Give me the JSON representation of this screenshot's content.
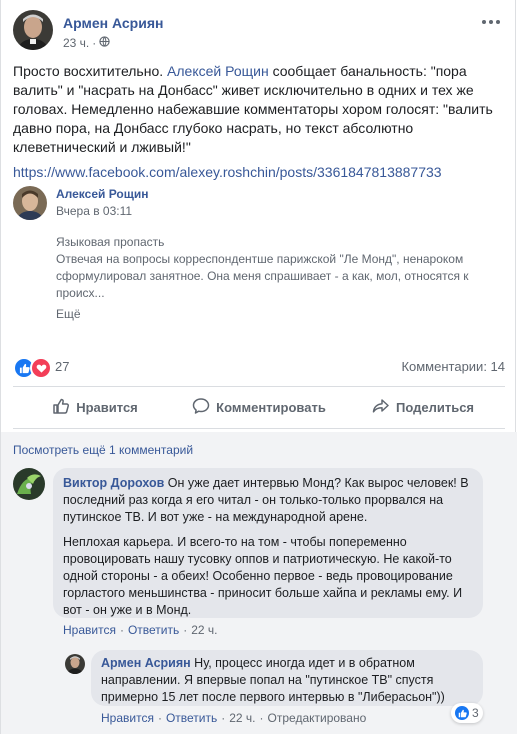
{
  "post": {
    "author": "Армен Асриян",
    "time": "23 ч.",
    "text_before": "Просто восхитительно. ",
    "mention": "Алексей Рощин",
    "text_after": " сообщает банальность: \"пора валить\" и \"насрать на Донбасс\" живет исключительно в одних и тех же головах. Немедленно набежавшие комментаторы хором голосят: \"валить давно пора, на Донбасс глубоко насрать, но текст абсолютно клеветнический и лживый!\"",
    "link": "https://www.facebook.com/alexey.roshchin/posts/3361847813887733"
  },
  "shared": {
    "author": "Алексей Рощин",
    "time": "Вчера в 03:11",
    "title": "Языковая пропасть",
    "body": "Отвечая на вопросы корреспондентше парижской \"Ле Монд\", ненароком сформулировал занятное. Она меня спрашивает - а как, мол, относятся к происх...",
    "more": "Ещё"
  },
  "stats": {
    "reactions": "27",
    "comments": "Комментарии: 14"
  },
  "actions": {
    "like": "Нравится",
    "comment": "Комментировать",
    "share": "Поделиться"
  },
  "comments_section": {
    "view_more": "Посмотреть ещё 1 комментарий"
  },
  "comment1": {
    "author": "Виктор Дорохов",
    "p1": " Он уже дает интервью Монд? Как вырос человек! В последний раз когда я его читал - он только-только прорвался на путинское ТВ. И вот уже - на международной арене.",
    "p2": "Неплохая карьера. И всего-то на том - чтобы попеременно провоцировать нашу тусовку оппов и патриотическую. Не какой-то одной стороны - а обеих! Особенно первое - ведь провоцирование горластого меньшинства - приносит больше хайпа и рекламы ему. И вот - он уже и в Монд.",
    "like": "Нравится",
    "reply": "Ответить",
    "time": "22 ч."
  },
  "comment2": {
    "author": "Армен Асриян",
    "text": " Ну, процесс иногда идет и в обратном направлении. Я впервые попал на \"путинское ТВ\" спустя примерно 15 лет после первого интервью в \"Либерасьон\"))",
    "like": "Нравится",
    "reply": "Ответить",
    "time": "22 ч.",
    "edited": "Отредактировано",
    "reactions": "3"
  },
  "colors": {
    "link": "#385898",
    "like_blue": "#1877f2",
    "love_red": "#f33e58"
  }
}
